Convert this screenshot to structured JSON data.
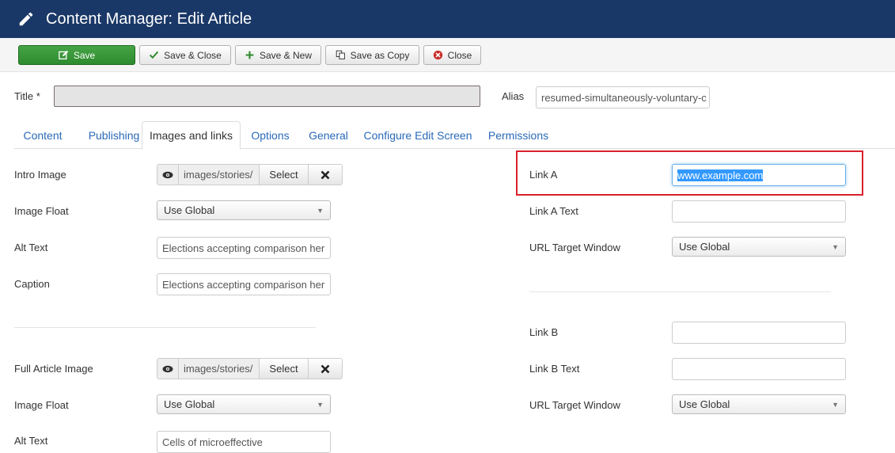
{
  "header": {
    "title": "Content Manager: Edit Article",
    "icon": "pencil-icon"
  },
  "toolbar": {
    "save": "Save",
    "save_close": "Save & Close",
    "save_new": "Save & New",
    "save_copy": "Save as Copy",
    "close": "Close"
  },
  "title_row": {
    "title_label": "Title *",
    "title_value": "",
    "alias_label": "Alias",
    "alias_value": "resumed-simultaneously-voluntary-c"
  },
  "tabs": [
    "Content",
    "Publishing",
    "Images and links",
    "Options",
    "General",
    "Configure Edit Screen",
    "Permissions"
  ],
  "intro": {
    "image_label": "Intro Image",
    "image_path": "images/stories/",
    "select_label": "Select",
    "float_label": "Image Float",
    "float_value": "Use Global",
    "alt_label": "Alt Text",
    "alt_value": "Elections accepting comparison her",
    "caption_label": "Caption",
    "caption_value": "Elections accepting comparison her"
  },
  "full": {
    "image_label": "Full Article Image",
    "image_path": "images/stories/",
    "select_label": "Select",
    "float_label": "Image Float",
    "float_value": "Use Global",
    "alt_label": "Alt Text",
    "alt_value": "Cells of microeffective"
  },
  "links": {
    "link_a_label": "Link A",
    "link_a_value": "www.example.com",
    "link_a_text_label": "Link A Text",
    "link_a_text_value": "",
    "target_a_label": "URL Target Window",
    "target_a_value": "Use Global",
    "link_b_label": "Link B",
    "link_b_value": "",
    "link_b_text_label": "Link B Text",
    "link_b_text_value": "",
    "target_b_label": "URL Target Window",
    "target_b_value": "Use Global"
  },
  "colors": {
    "header": "#1a3867",
    "save": "#46a546",
    "link": "#2a69b8",
    "highlight": "#d9212c"
  }
}
